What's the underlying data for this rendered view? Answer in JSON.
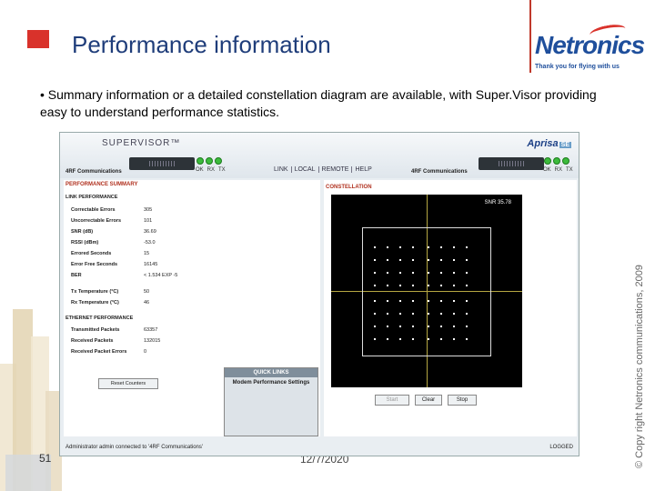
{
  "slide": {
    "title": "Performance information",
    "bullet": "• Summary information or a detailed constellation diagram are available, with Super.Visor providing easy to understand performance statistics.",
    "page_number": "51",
    "date": "12/7/2020",
    "copyright": "© Copy right Netronics communications, 2009",
    "brand_name": "Netronics",
    "brand_tagline": "Thank you for flying with us",
    "accent_color": "#d9322b",
    "title_color": "#1f3d7a"
  },
  "app": {
    "logo": "SUPERVISOR™",
    "aprisa_logo": "Aprisa",
    "aprisa_tag": "SE",
    "company_left": "4RF Communications",
    "company_right": "4RF Communications",
    "led_labels": [
      "OK",
      "RX",
      "TX"
    ],
    "nav": [
      "LINK",
      "LOCAL",
      "REMOTE",
      "HELP"
    ],
    "left_panel": {
      "title": "PERFORMANCE SUMMARY",
      "link_title": "LINK PERFORMANCE",
      "link_rows": [
        {
          "label": "Correctable Errors",
          "value": "305"
        },
        {
          "label": "Uncorrectable Errors",
          "value": "101"
        },
        {
          "label": "SNR (dB)",
          "value": "36.69"
        },
        {
          "label": "RSSI (dBm)",
          "value": "-53.0"
        },
        {
          "label": "Errored Seconds",
          "value": "15"
        },
        {
          "label": "Error Free Seconds",
          "value": "16145"
        },
        {
          "label": "BER",
          "value": "< 1.534 EXP -5"
        },
        {
          "label": "Tx Temperature (°C)",
          "value": "50"
        },
        {
          "label": "Rx Temperature (°C)",
          "value": "46"
        }
      ],
      "eth_title": "ETHERNET PERFORMANCE",
      "eth_rows": [
        {
          "label": "Transmitted Packets",
          "value": "63357"
        },
        {
          "label": "Received Packets",
          "value": "132015"
        },
        {
          "label": "Received Packet Errors",
          "value": "0"
        }
      ],
      "reset_label": "Reset Counters",
      "quick_links_title": "QUICK LINKS",
      "quick_link": "Modem Performance Settings"
    },
    "right_panel": {
      "title": "CONSTELLATION",
      "snr": "SNR 35.78",
      "start": "Start",
      "clear": "Clear",
      "stop": "Stop"
    },
    "status": {
      "message": "Administrator admin connected to '4RF Communications'",
      "state": "LOGGED"
    }
  }
}
